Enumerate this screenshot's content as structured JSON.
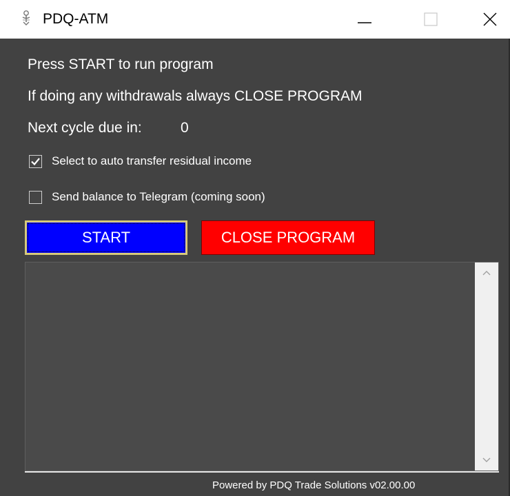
{
  "window": {
    "title": "PDQ-ATM",
    "icon": "pdq-app-icon",
    "controls": [
      "minimize-icon",
      "maximize-icon",
      "close-icon"
    ]
  },
  "info": {
    "line1": "Press START to run program",
    "line2": "If doing any withdrawals always CLOSE PROGRAM",
    "next_cycle_label": "Next cycle due in:",
    "next_cycle_value": "0"
  },
  "options": [
    {
      "label": "Select to auto transfer residual income",
      "checked": true
    },
    {
      "label": "Send balance to Telegram (coming soon)",
      "checked": false
    }
  ],
  "buttons": {
    "start_label": "START",
    "close_label": "CLOSE PROGRAM"
  },
  "colors": {
    "background": "#424242",
    "start_button": "#0000ff",
    "close_button": "#ff0000",
    "text": "#ffffff"
  },
  "output": {
    "content": ""
  },
  "footer": {
    "text": "Powered by PDQ Trade Solutions v02.00.00"
  }
}
